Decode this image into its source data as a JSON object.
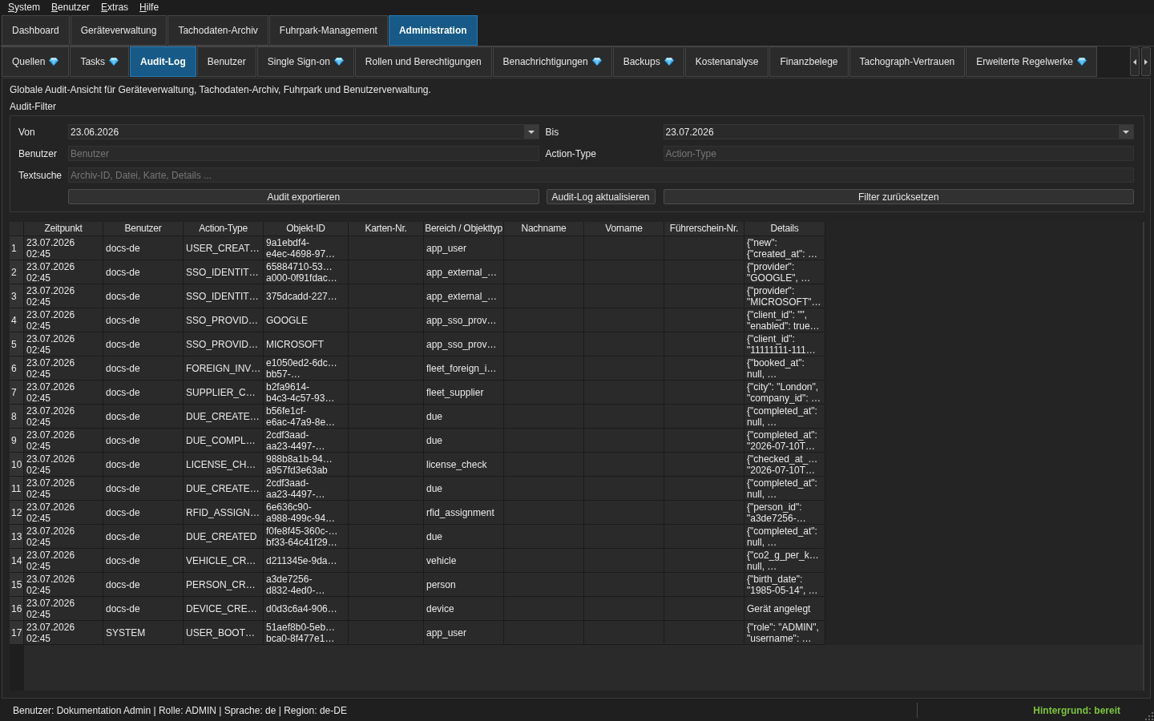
{
  "menu": [
    "System",
    "Benutzer",
    "Extras",
    "Hilfe"
  ],
  "main_tabs": [
    {
      "label": "Dashboard",
      "selected": false
    },
    {
      "label": "Geräteverwaltung",
      "selected": false
    },
    {
      "label": "Tachodaten-Archiv",
      "selected": false
    },
    {
      "label": "Fuhrpark-Management",
      "selected": false
    },
    {
      "label": "Administration",
      "selected": true
    }
  ],
  "sub_tabs": [
    {
      "label": "Quellen",
      "gem": true,
      "selected": false
    },
    {
      "label": "Tasks",
      "gem": true,
      "selected": false
    },
    {
      "label": "Audit-Log",
      "gem": false,
      "selected": true
    },
    {
      "label": "Benutzer",
      "gem": false,
      "selected": false
    },
    {
      "label": "Single Sign-on",
      "gem": true,
      "selected": false
    },
    {
      "label": "Rollen und Berechtigungen",
      "gem": false,
      "selected": false
    },
    {
      "label": "Benachrichtigungen",
      "gem": true,
      "selected": false
    },
    {
      "label": "Backups",
      "gem": true,
      "selected": false
    },
    {
      "label": "Kostenanalyse",
      "gem": false,
      "selected": false
    },
    {
      "label": "Finanzbelege",
      "gem": false,
      "selected": false
    },
    {
      "label": "Tachograph-Vertrauen",
      "gem": false,
      "selected": false
    },
    {
      "label": "Erweiterte Regelwerke",
      "gem": true,
      "selected": false
    }
  ],
  "description": "Globale Audit-Ansicht für Geräteverwaltung, Tachodaten-Archiv, Fuhrpark und Benutzerverwaltung.",
  "audit_filter": {
    "title": "Audit-Filter",
    "von": {
      "label": "Von",
      "value": "23.06.2026"
    },
    "bis": {
      "label": "Bis",
      "value": "23.07.2026"
    },
    "benutzer": {
      "label": "Benutzer",
      "placeholder": "Benutzer"
    },
    "action_type": {
      "label": "Action-Type",
      "placeholder": "Action-Type"
    },
    "textsuche": {
      "label": "Textsuche",
      "placeholder": "Archiv-ID, Datei, Karte, Details ..."
    },
    "buttons": [
      "Audit exportieren",
      "Audit-Log aktualisieren",
      "Filter zurücksetzen"
    ]
  },
  "table": {
    "columns": [
      "Zeitpunkt",
      "Benutzer",
      "Action-Type",
      "Objekt-ID",
      "Karten-Nr.",
      "Bereich / Objekttyp",
      "Nachname",
      "Vorname",
      "Führerschein-Nr.",
      "Details"
    ],
    "rows": [
      {
        "number": "1",
        "zeitpunkt": "23.07.2026\n02:45",
        "benutzer": "docs-de",
        "action_type": "USER_CREAT…",
        "objekt_id": "9a1ebdf4-\ne4ec-4698-97…",
        "bereich_objekttyp": "app_user",
        "details": "{\"new\":\n{\"created_at\": …"
      },
      {
        "number": "2",
        "zeitpunkt": "23.07.2026\n02:45",
        "benutzer": "docs-de",
        "action_type": "SSO_IDENTIT…",
        "objekt_id": "65884710-53…\na000-0f91fdac…",
        "bereich_objekttyp": "app_external_…",
        "details": "{\"provider\":\n\"GOOGLE\", …"
      },
      {
        "number": "3",
        "zeitpunkt": "23.07.2026\n02:45",
        "benutzer": "docs-de",
        "action_type": "SSO_IDENTIT…",
        "objekt_id": "375dcadd-227…",
        "bereich_objekttyp": "app_external_…",
        "details": "{\"provider\":\n\"MICROSOFT\"…"
      },
      {
        "number": "4",
        "zeitpunkt": "23.07.2026\n02:45",
        "benutzer": "docs-de",
        "action_type": "SSO_PROVID…",
        "objekt_id": "GOOGLE",
        "bereich_objekttyp": "app_sso_prov…",
        "details": "{\"client_id\": \"\",\n\"enabled\": true…"
      },
      {
        "number": "5",
        "zeitpunkt": "23.07.2026\n02:45",
        "benutzer": "docs-de",
        "action_type": "SSO_PROVID…",
        "objekt_id": "MICROSOFT",
        "bereich_objekttyp": "app_sso_prov…",
        "details": "{\"client_id\":\n\"11111111-111…"
      },
      {
        "number": "6",
        "zeitpunkt": "23.07.2026\n02:45",
        "benutzer": "docs-de",
        "action_type": "FOREIGN_INV…",
        "objekt_id": "e1050ed2-6dc…\nbb57-…",
        "bereich_objekttyp": "fleet_foreign_i…",
        "details": "{\"booked_at\":\nnull, …"
      },
      {
        "number": "7",
        "zeitpunkt": "23.07.2026\n02:45",
        "benutzer": "docs-de",
        "action_type": "SUPPLIER_C…",
        "objekt_id": "b2fa9614-\nb4c3-4c57-93…",
        "bereich_objekttyp": "fleet_supplier",
        "details": "{\"city\": \"London\",\n\"company_id\": …"
      },
      {
        "number": "8",
        "zeitpunkt": "23.07.2026\n02:45",
        "benutzer": "docs-de",
        "action_type": "DUE_CREATE…",
        "objekt_id": "b56fe1cf-\ne6ac-47a9-8e…",
        "bereich_objekttyp": "due",
        "details": "{\"completed_at\":\nnull, …"
      },
      {
        "number": "9",
        "zeitpunkt": "23.07.2026\n02:45",
        "benutzer": "docs-de",
        "action_type": "DUE_COMPL…",
        "objekt_id": "2cdf3aad-\naa23-4497-…",
        "bereich_objekttyp": "due",
        "details": "{\"completed_at\":\n\"2026-07-10T…"
      },
      {
        "number": "10",
        "zeitpunkt": "23.07.2026\n02:45",
        "benutzer": "docs-de",
        "action_type": "LICENSE_CH…",
        "objekt_id": "988b8a1b-94…\na957fd3e63ab",
        "bereich_objekttyp": "license_check",
        "details": "{\"checked_at_…\n\"2026-07-10T…"
      },
      {
        "number": "11",
        "zeitpunkt": "23.07.2026\n02:45",
        "benutzer": "docs-de",
        "action_type": "DUE_CREATE…",
        "objekt_id": "2cdf3aad-\naa23-4497-…",
        "bereich_objekttyp": "due",
        "details": "{\"completed_at\":\nnull, …"
      },
      {
        "number": "12",
        "zeitpunkt": "23.07.2026\n02:45",
        "benutzer": "docs-de",
        "action_type": "RFID_ASSIGN…",
        "objekt_id": "6e636c90-\na988-499c-94…",
        "bereich_objekttyp": "rfid_assignment",
        "details": "{\"person_id\":\n\"a3de7256-…"
      },
      {
        "number": "13",
        "zeitpunkt": "23.07.2026\n02:45",
        "benutzer": "docs-de",
        "action_type": "DUE_CREATED",
        "objekt_id": "f0fe8f45-360c-…\nbf33-64c41f29…",
        "bereich_objekttyp": "due",
        "details": "{\"completed_at\":\nnull, …"
      },
      {
        "number": "14",
        "zeitpunkt": "23.07.2026\n02:45",
        "benutzer": "docs-de",
        "action_type": "VEHICLE_CR…",
        "objekt_id": "d211345e-9da…",
        "bereich_objekttyp": "vehicle",
        "details": "{\"co2_g_per_k…\nnull, …"
      },
      {
        "number": "15",
        "zeitpunkt": "23.07.2026\n02:45",
        "benutzer": "docs-de",
        "action_type": "PERSON_CR…",
        "objekt_id": "a3de7256-\nd832-4ed0-…",
        "bereich_objekttyp": "person",
        "details": "{\"birth_date\":\n\"1985-05-14\", …"
      },
      {
        "number": "16",
        "zeitpunkt": "23.07.2026\n02:45",
        "benutzer": "docs-de",
        "action_type": "DEVICE_CRE…",
        "objekt_id": "d0d3c6a4-906…",
        "bereich_objekttyp": "device",
        "details": "Gerät angelegt"
      },
      {
        "number": "17",
        "zeitpunkt": "23.07.2026\n02:45",
        "benutzer": "SYSTEM",
        "action_type": "USER_BOOT…",
        "objekt_id": "51aef8b0-5eb…\nbca0-8f477e1…",
        "bereich_objekttyp": "app_user",
        "details": "{\"role\": \"ADMIN\",\n\"username\": …"
      }
    ]
  },
  "status_bar": {
    "info": "Benutzer: Dokumentation Admin | Rolle: ADMIN | Sprache: de | Region: de-DE",
    "background_status": "Hintergrund: bereit"
  }
}
